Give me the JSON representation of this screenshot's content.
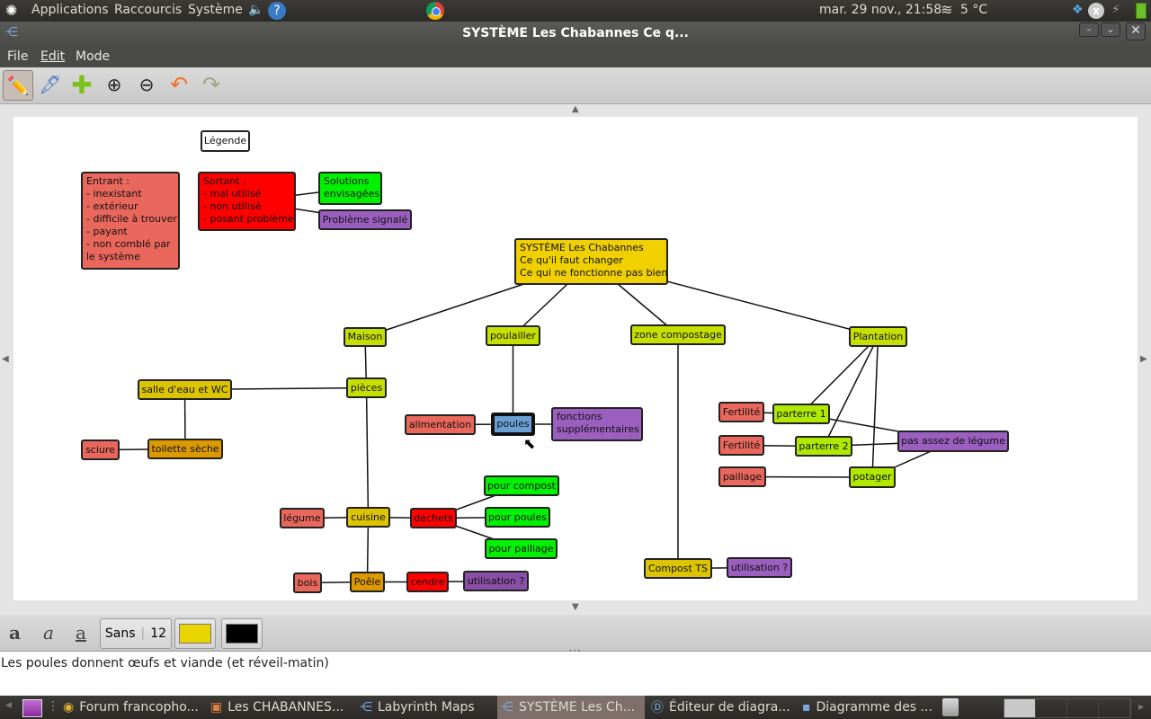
{
  "top_panel": {
    "menus": [
      "Applications",
      "Raccourcis",
      "Système"
    ],
    "datetime": "mar. 29 nov., 21:58",
    "weather": "5 °C"
  },
  "window": {
    "title": "SYSTÈME Les Chabannes Ce q...",
    "menu": [
      "File",
      "Edit",
      "Mode"
    ]
  },
  "toolbar": {
    "tools": [
      "edit-pencil",
      "eyedropper",
      "add-node",
      "zoom-in",
      "zoom-out",
      "undo",
      "redo"
    ]
  },
  "diagram": {
    "nodes": [
      {
        "id": "legende",
        "lines": [
          "Légende"
        ],
        "color": "#ffffff"
      },
      {
        "id": "entrant",
        "lines": [
          "Entrant :",
          "- inexistant",
          "- extérieur",
          "- difficile à trouver",
          "- payant",
          "- non comblé par",
          "le système"
        ],
        "color": "#e9675c"
      },
      {
        "id": "sortant",
        "lines": [
          "Sortant :",
          "- mal utilisé",
          "- non utilisé",
          "- posant problème"
        ],
        "color": "#ff0000"
      },
      {
        "id": "solutions",
        "lines": [
          "Solutions",
          "envisagées"
        ],
        "color": "#00f200"
      },
      {
        "id": "probleme",
        "lines": [
          "Problème signalé"
        ],
        "color": "#9b5fbf"
      },
      {
        "id": "root",
        "lines": [
          "SYSTÈME Les Chabannes",
          "Ce qu'il faut changer",
          "Ce qui ne fonctionne pas bien"
        ],
        "color": "#f0d000"
      },
      {
        "id": "maison",
        "lines": [
          "Maison"
        ],
        "color": "#c5e000"
      },
      {
        "id": "poulailler",
        "lines": [
          "poulailler"
        ],
        "color": "#c5e000"
      },
      {
        "id": "compostage",
        "lines": [
          "zone compostage"
        ],
        "color": "#c5e000"
      },
      {
        "id": "plantation",
        "lines": [
          "Plantation"
        ],
        "color": "#c5e000"
      },
      {
        "id": "pieces",
        "lines": [
          "pièces"
        ],
        "color": "#c5e000"
      },
      {
        "id": "salle",
        "lines": [
          "salle d'eau et WC"
        ],
        "color": "#dcc400"
      },
      {
        "id": "toilette",
        "lines": [
          "toilette sèche"
        ],
        "color": "#dc9a00"
      },
      {
        "id": "sciure",
        "lines": [
          "sciure"
        ],
        "color": "#e9675c"
      },
      {
        "id": "poules",
        "lines": [
          "poules"
        ],
        "color": "#6a9fd4"
      },
      {
        "id": "alimentation",
        "lines": [
          "alimentation"
        ],
        "color": "#e9675c"
      },
      {
        "id": "fonctions",
        "lines": [
          "fonctions",
          "supplémentaires"
        ],
        "color": "#9b5fbf"
      },
      {
        "id": "cuisine",
        "lines": [
          "cuisine"
        ],
        "color": "#dcc400"
      },
      {
        "id": "legume",
        "lines": [
          "légume"
        ],
        "color": "#e9675c"
      },
      {
        "id": "dechets",
        "lines": [
          "déchets"
        ],
        "color": "#ff0000"
      },
      {
        "id": "pcompost",
        "lines": [
          "pour compost"
        ],
        "color": "#00f200"
      },
      {
        "id": "ppoules",
        "lines": [
          "pour poules"
        ],
        "color": "#00f200"
      },
      {
        "id": "ppaillage",
        "lines": [
          "pour paillage"
        ],
        "color": "#00f200"
      },
      {
        "id": "poele",
        "lines": [
          "Poêle"
        ],
        "color": "#dc9a00"
      },
      {
        "id": "bois",
        "lines": [
          "bois"
        ],
        "color": "#e9675c"
      },
      {
        "id": "cendre",
        "lines": [
          "cendre"
        ],
        "color": "#ff0000"
      },
      {
        "id": "util1",
        "lines": [
          "utilisation ?"
        ],
        "color": "#8a4fa6"
      },
      {
        "id": "compostts",
        "lines": [
          "Compost TS"
        ],
        "color": "#dcc400"
      },
      {
        "id": "util2",
        "lines": [
          "utilisation ?"
        ],
        "color": "#9b5fbf"
      },
      {
        "id": "fert1",
        "lines": [
          "Fertilité"
        ],
        "color": "#e9675c"
      },
      {
        "id": "parterre1",
        "lines": [
          "parterre 1"
        ],
        "color": "#b0e800"
      },
      {
        "id": "fert2",
        "lines": [
          "Fertilité"
        ],
        "color": "#e9675c"
      },
      {
        "id": "parterre2",
        "lines": [
          "parterre 2"
        ],
        "color": "#b0e800"
      },
      {
        "id": "pasassez",
        "lines": [
          "pas assez de légume"
        ],
        "color": "#9b5fbf"
      },
      {
        "id": "paillage",
        "lines": [
          "paillage"
        ],
        "color": "#e9675c"
      },
      {
        "id": "potager",
        "lines": [
          "potager"
        ],
        "color": "#b0e800"
      }
    ],
    "edges": [
      [
        "sortant",
        "solutions"
      ],
      [
        "sortant",
        "probleme"
      ],
      [
        "root",
        "maison"
      ],
      [
        "root",
        "poulailler"
      ],
      [
        "root",
        "compostage"
      ],
      [
        "root",
        "plantation"
      ],
      [
        "maison",
        "pieces"
      ],
      [
        "pieces",
        "salle"
      ],
      [
        "salle",
        "toilette"
      ],
      [
        "toilette",
        "sciure"
      ],
      [
        "pieces",
        "cuisine"
      ],
      [
        "cuisine",
        "legume"
      ],
      [
        "cuisine",
        "dechets"
      ],
      [
        "dechets",
        "pcompost"
      ],
      [
        "dechets",
        "ppoules"
      ],
      [
        "dechets",
        "ppaillage"
      ],
      [
        "cuisine",
        "poele"
      ],
      [
        "poele",
        "bois"
      ],
      [
        "poele",
        "cendre"
      ],
      [
        "cendre",
        "util1"
      ],
      [
        "poulailler",
        "poules"
      ],
      [
        "poules",
        "alimentation"
      ],
      [
        "poules",
        "fonctions"
      ],
      [
        "compostage",
        "compostts"
      ],
      [
        "compostts",
        "util2"
      ],
      [
        "plantation",
        "parterre1"
      ],
      [
        "plantation",
        "parterre2"
      ],
      [
        "plantation",
        "potager"
      ],
      [
        "parterre1",
        "fert1"
      ],
      [
        "parterre2",
        "fert2"
      ],
      [
        "parterre1",
        "pasassez"
      ],
      [
        "parterre2",
        "pasassez"
      ],
      [
        "potager",
        "pasassez"
      ],
      [
        "potager",
        "paillage"
      ]
    ],
    "selected": "poules"
  },
  "formatbar": {
    "font_name": "Sans",
    "font_size": "12",
    "fill_color": "#e8d400",
    "text_color": "#000000"
  },
  "notes": {
    "text": "Les poules donnent œufs et viande (et réveil-matin)"
  },
  "taskbar": {
    "tasks": [
      {
        "label": "Forum francopho...",
        "icon": "chrome-icon"
      },
      {
        "label": "Les CHABANNES...",
        "icon": "folder-icon"
      },
      {
        "label": "Labyrinth Maps",
        "icon": "labyrinth-icon"
      },
      {
        "label": "SYSTÈME Les Ch...",
        "icon": "labyrinth-icon",
        "active": true
      },
      {
        "label": "Éditeur de diagra...",
        "icon": "dia-icon"
      },
      {
        "label": "Diagramme des ...",
        "icon": "image-icon"
      }
    ]
  }
}
